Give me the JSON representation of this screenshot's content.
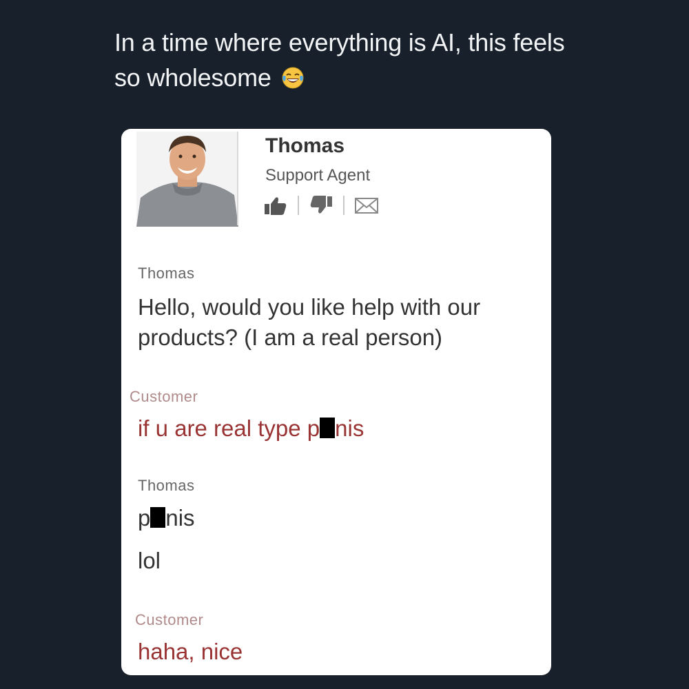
{
  "caption": {
    "text": "In a time where everything is AI, this feels so wholesome",
    "emoji": "face-with-tears-of-joy-icon"
  },
  "agent": {
    "name": "Thomas",
    "role": "Support Agent",
    "actions": [
      "thumbs-up-icon",
      "thumbs-down-icon",
      "envelope-icon"
    ]
  },
  "messages": [
    {
      "sender": "Thomas",
      "role": "agent",
      "lines": [
        "Hello, would you like help with our",
        "products? (I am a real person)"
      ]
    },
    {
      "sender": "Customer",
      "role": "customer",
      "parts": [
        "if u are real type p",
        "nis"
      ]
    },
    {
      "sender": "Thomas",
      "role": "agent",
      "parts": [
        "p",
        "nis"
      ],
      "extra_line": "lol"
    },
    {
      "sender": "Customer",
      "role": "customer",
      "lines": [
        "haha, nice"
      ]
    }
  ],
  "colors": {
    "background": "#18202b",
    "card": "#ffffff",
    "customer_text": "#9a3434",
    "agent_text": "#333333"
  }
}
